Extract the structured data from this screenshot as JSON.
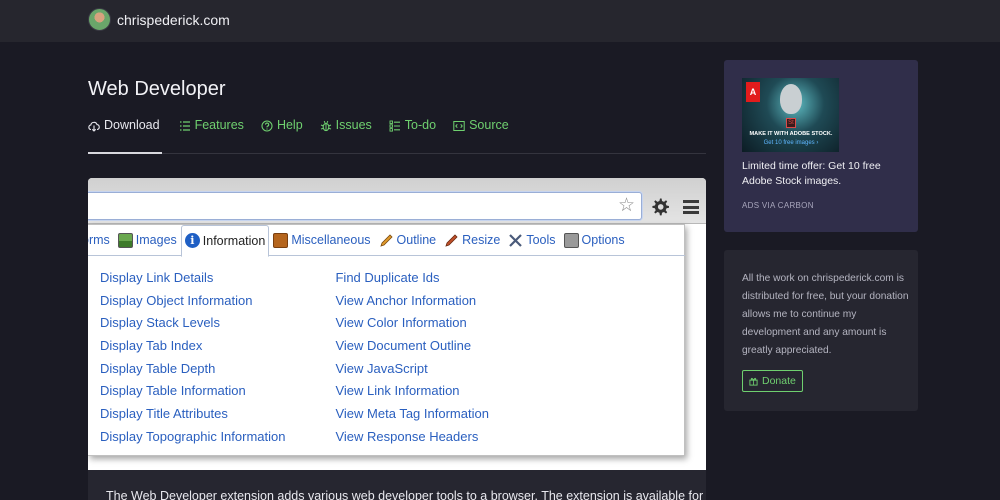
{
  "header": {
    "site_name": "chrispederick.com"
  },
  "page": {
    "title": "Web Developer",
    "tabs": [
      {
        "label": "Download",
        "icon": "cloud-download-icon",
        "active": true
      },
      {
        "label": "Features",
        "icon": "list-icon"
      },
      {
        "label": "Help",
        "icon": "question-circle-icon"
      },
      {
        "label": "Issues",
        "icon": "bug-icon"
      },
      {
        "label": "To-do",
        "icon": "checklist-icon"
      },
      {
        "label": "Source",
        "icon": "code-icon"
      }
    ],
    "description": "The Web Developer extension adds various web developer tools to a browser. The extension is available for"
  },
  "screenshot": {
    "toolbar_tabs": [
      {
        "label": "orms",
        "icon": "forms-icon"
      },
      {
        "label": "Images",
        "icon": "images-icon"
      },
      {
        "label": "Information",
        "icon": "info-icon",
        "active": true
      },
      {
        "label": "Miscellaneous",
        "icon": "book-icon"
      },
      {
        "label": "Outline",
        "icon": "pencil-icon"
      },
      {
        "label": "Resize",
        "icon": "resize-icon"
      },
      {
        "label": "Tools",
        "icon": "tools-icon"
      },
      {
        "label": "Options",
        "icon": "options-icon"
      }
    ],
    "menu_left": [
      "Display Link Details",
      "Display Object Information",
      "Display Stack Levels",
      "Display Tab Index",
      "Display Table Depth",
      "Display Table Information",
      "Display Title Attributes",
      "Display Topographic Information"
    ],
    "menu_right": [
      "Find Duplicate Ids",
      "View Anchor Information",
      "View Color Information",
      "View Document Outline",
      "View JavaScript",
      "View Link Information",
      "View Meta Tag Information",
      "View Response Headers"
    ]
  },
  "sidebar": {
    "ad": {
      "image_logo": "A",
      "image_badge": "St",
      "image_headline": "MAKE IT WITH ADOBE STOCK.",
      "image_cta": "Get 10 free images ›",
      "text": "Limited time offer: Get 10 free Adobe Stock images.",
      "via": "ADS VIA CARBON"
    },
    "donate": {
      "text": "All the work on chrispederick.com is distributed for free, but your donation allows me to continue my development and any amount is greatly appreciated.",
      "button_label": "Donate"
    }
  },
  "colors": {
    "background": "#1a1a24",
    "topbar": "#26262e",
    "accent_green": "#6fd06f",
    "ad_panel": "#302e4a",
    "link_blue": "#2a5fbf"
  }
}
